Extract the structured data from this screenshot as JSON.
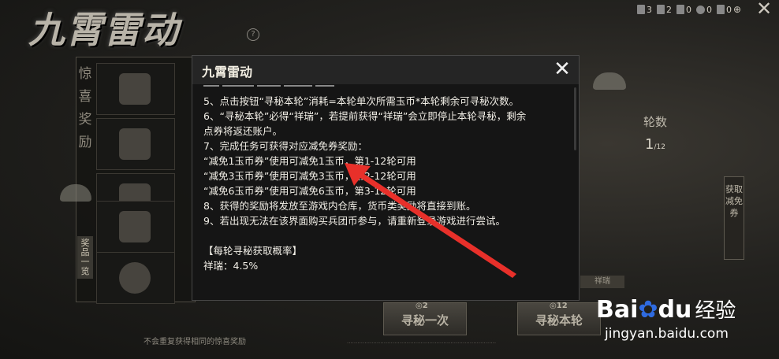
{
  "game": {
    "title": "九霄雷动",
    "help_icon": "?",
    "left_tab_title": "惊喜奖励",
    "left_tab_sub": "奖品一览",
    "bottom_note": "不会重复获得相同的惊喜奖励",
    "round_label": "轮数",
    "round_value": "1",
    "round_total": "/12",
    "side_tab_label": "获取减免券",
    "lucky_tag": "祥瑞",
    "btn_once": "寻秘一次",
    "btn_once_cost": "2",
    "btn_round": "寻秘本轮",
    "btn_round_cost": "12",
    "close_icon": "close-icon",
    "resources": [
      {
        "icon": "coupon-icon",
        "count": "3"
      },
      {
        "icon": "coupon-icon",
        "count": "2"
      },
      {
        "icon": "coupon-icon",
        "count": "0"
      },
      {
        "icon": "coin-icon",
        "count": "0"
      },
      {
        "icon": "coupon-icon",
        "count": "0"
      }
    ]
  },
  "modal": {
    "title": "九霄雷动",
    "close_icon": "close-icon",
    "lines": [
      "5、点击按钮“寻秘本轮”消耗=本轮单次所需玉币*本轮剩余可寻秘次数。",
      "6、“寻秘本轮”必得“祥瑞”，若提前获得“祥瑞”会立即停止本轮寻秘，剩余",
      "点券将返还账户。",
      "7、完成任务可获得对应减免券奖励：",
      "“减免1玉币券”使用可减免1玉币，第1-12轮可用",
      "“减免3玉币券”使用可减免3玉币，第2-12轮可用",
      "“减免6玉币券”使用可减免6玉币，第3-12轮可用",
      "8、获得的奖励将发放至游戏内仓库，货币类奖励将直接到账。",
      "9、若出现无法在该界面购买兵团币参与，请重新登录游戏进行尝试。"
    ],
    "prob_header": "【每轮寻秘获取概率】",
    "prob_line": "祥瑞：4.5%"
  },
  "watermark": {
    "logo": "Bai",
    "logo_end": "du",
    "cn": "经验",
    "url": "jingyan.baidu.com"
  },
  "colors": {
    "arrow": "#e8302a",
    "modal_bg": "#151515",
    "baidu_blue": "#2f6be0"
  }
}
